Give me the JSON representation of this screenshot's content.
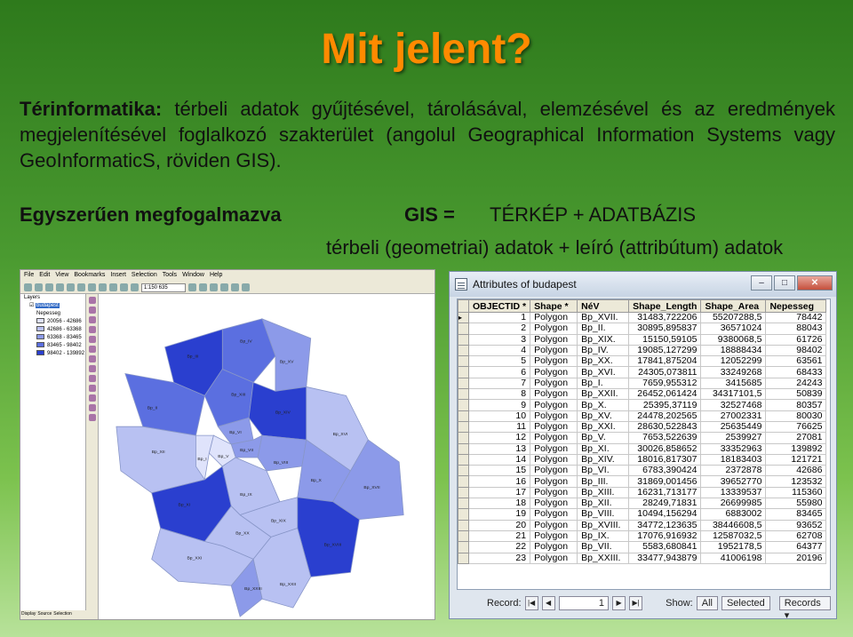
{
  "slide": {
    "title": "Mit jelent?",
    "definition_term": "Térinformatika:",
    "definition_text": " térbeli adatok gyűjtésével, tárolásával, elemzésével és az eredmények megjelenítésével foglalkozó szakterület (angolul Geographical Information Systems vagy GeoInformaticS, röviden GIS).",
    "simply_label": "Egyszerűen megfogalmazva",
    "gis_label": "GIS =",
    "gis_formula": "TÉRKÉP + ADATBÁZIS",
    "gis_formula2": "térbeli (geometriai) adatok + leíró (attribútum) adatok"
  },
  "arcmap": {
    "menu": [
      "File",
      "Edit",
      "View",
      "Bookmarks",
      "Insert",
      "Selection",
      "Tools",
      "Window",
      "Help"
    ],
    "scale": "1:150 635",
    "toc_layers": "Layers",
    "toc_layer": "budapest",
    "toc_field": "Nepesseg",
    "legend": [
      {
        "range": "20056 - 42686",
        "color": "#dfe3fb"
      },
      {
        "range": "42686 - 63368",
        "color": "#b8c1f2"
      },
      {
        "range": "63368 - 83465",
        "color": "#8c9ae9"
      },
      {
        "range": "83465 - 98402",
        "color": "#5b6fe0"
      },
      {
        "range": "98402 - 139892",
        "color": "#2a3fcf"
      }
    ],
    "tabs": [
      "Display",
      "Source",
      "Selection"
    ],
    "districts": [
      {
        "name": "Bp_IV"
      },
      {
        "name": "Bp_III"
      },
      {
        "name": "Bp_XV"
      },
      {
        "name": "Bp_II"
      },
      {
        "name": "Bp_XIII"
      },
      {
        "name": "Bp_XIV"
      },
      {
        "name": "Bp_XVI"
      },
      {
        "name": "Bp_XII"
      },
      {
        "name": "Bp_VI"
      },
      {
        "name": "Bp_VII"
      },
      {
        "name": "Bp_V"
      },
      {
        "name": "Bp_I"
      },
      {
        "name": "Bp_VIII"
      },
      {
        "name": "Bp_X"
      },
      {
        "name": "Bp_XVII"
      },
      {
        "name": "Bp_XI"
      },
      {
        "name": "Bp_IX"
      },
      {
        "name": "Bp_XIX"
      },
      {
        "name": "Bp_XX"
      },
      {
        "name": "Bp_XVIII"
      },
      {
        "name": "Bp_XXII"
      },
      {
        "name": "Bp_XXI"
      },
      {
        "name": "Bp_XXIII"
      }
    ]
  },
  "attributes": {
    "title": "Attributes of budapest",
    "columns": [
      "OBJECTID *",
      "Shape *",
      "NéV",
      "Shape_Length",
      "Shape_Area",
      "Nepesseg"
    ],
    "rows": [
      [
        "1",
        "Polygon",
        "Bp_XVII.",
        "31483,722206",
        "55207288,5",
        "78442"
      ],
      [
        "2",
        "Polygon",
        "Bp_II.",
        "30895,895837",
        "36571024",
        "88043"
      ],
      [
        "3",
        "Polygon",
        "Bp_XIX.",
        "15150,59105",
        "9380068,5",
        "61726"
      ],
      [
        "4",
        "Polygon",
        "Bp_IV.",
        "19085,127299",
        "18888434",
        "98402"
      ],
      [
        "5",
        "Polygon",
        "Bp_XX.",
        "17841,875204",
        "12052299",
        "63561"
      ],
      [
        "6",
        "Polygon",
        "Bp_XVI.",
        "24305,073811",
        "33249268",
        "68433"
      ],
      [
        "7",
        "Polygon",
        "Bp_I.",
        "7659,955312",
        "3415685",
        "24243"
      ],
      [
        "8",
        "Polygon",
        "Bp_XXII.",
        "26452,061424",
        "34317101,5",
        "50839"
      ],
      [
        "9",
        "Polygon",
        "Bp_X.",
        "25395,37119",
        "32527468",
        "80357"
      ],
      [
        "10",
        "Polygon",
        "Bp_XV.",
        "24478,202565",
        "27002331",
        "80030"
      ],
      [
        "11",
        "Polygon",
        "Bp_XXI.",
        "28630,522843",
        "25635449",
        "76625"
      ],
      [
        "12",
        "Polygon",
        "Bp_V.",
        "7653,522639",
        "2539927",
        "27081"
      ],
      [
        "13",
        "Polygon",
        "Bp_XI.",
        "30026,858652",
        "33352963",
        "139892"
      ],
      [
        "14",
        "Polygon",
        "Bp_XIV.",
        "18016,817307",
        "18183403",
        "121721"
      ],
      [
        "15",
        "Polygon",
        "Bp_VI.",
        "6783,390424",
        "2372878",
        "42686"
      ],
      [
        "16",
        "Polygon",
        "Bp_III.",
        "31869,001456",
        "39652770",
        "123532"
      ],
      [
        "17",
        "Polygon",
        "Bp_XIII.",
        "16231,713177",
        "13339537",
        "115360"
      ],
      [
        "18",
        "Polygon",
        "Bp_XII.",
        "28249,71831",
        "26699985",
        "55980"
      ],
      [
        "19",
        "Polygon",
        "Bp_VIII.",
        "10494,156294",
        "6883002",
        "83465"
      ],
      [
        "20",
        "Polygon",
        "Bp_XVIII.",
        "34772,123635",
        "38446608,5",
        "93652"
      ],
      [
        "21",
        "Polygon",
        "Bp_IX.",
        "17076,916932",
        "12587032,5",
        "62708"
      ],
      [
        "22",
        "Polygon",
        "Bp_VII.",
        "5583,680841",
        "1952178,5",
        "64377"
      ],
      [
        "23",
        "Polygon",
        "Bp_XXIII.",
        "33477,943879",
        "41006198",
        "20196"
      ]
    ],
    "footer": {
      "record_label": "Record:",
      "record_value": "1",
      "show_label": "Show:",
      "show_all": "All",
      "show_selected": "Selected",
      "records_label": "Records"
    }
  }
}
